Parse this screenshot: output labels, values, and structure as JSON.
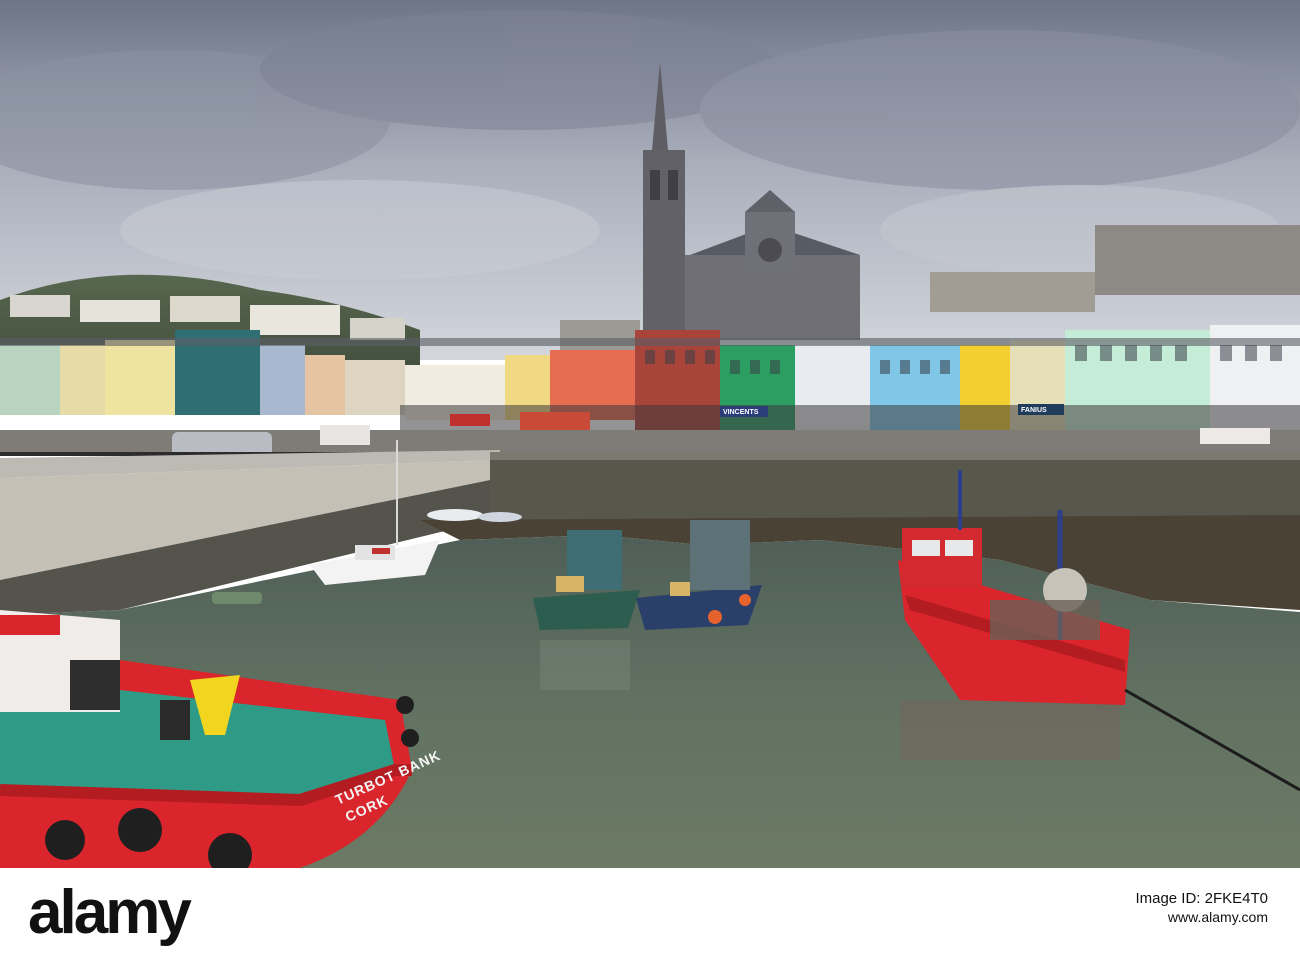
{
  "photo": {
    "boat_name_line1": "TURBOT BANK",
    "boat_name_line2": "CORK",
    "shop_signs": [
      "VINCENTS",
      "FANIUS"
    ]
  },
  "footer": {
    "logo_alamy": "alamy",
    "image_id_label": "Image ID: 2FKE4T0",
    "url": "www.alamy.com"
  },
  "colors": {
    "sky": "#b9bdc6",
    "water": "#5e6c5b",
    "boat_red": "#d9252b",
    "deck_green": "#2f9a86",
    "cathedral": "#6b6b70"
  }
}
